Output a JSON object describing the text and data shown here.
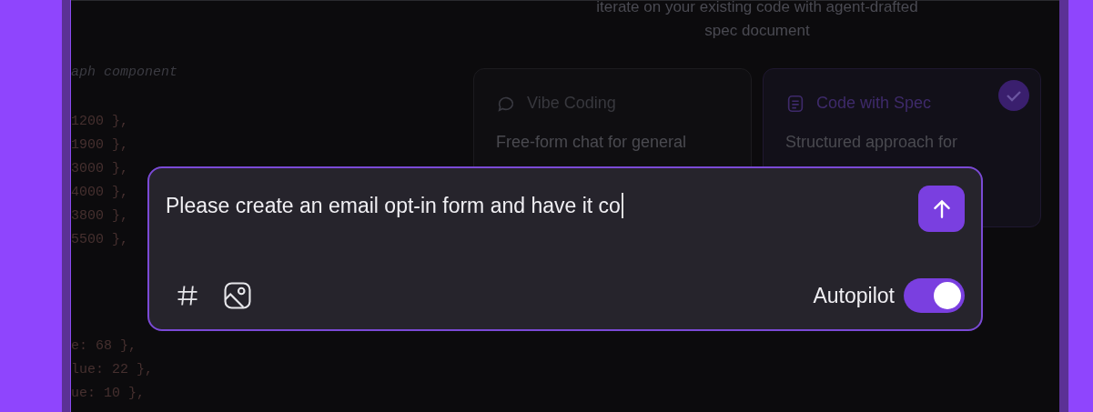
{
  "code_blocks": [
    {
      "lines": [
        {
          "kind": "comment",
          "text": "aph component"
        }
      ]
    },
    {
      "lines": [
        {
          "kind": "value",
          "text": "1200 },"
        },
        {
          "kind": "value",
          "text": "1900 },"
        },
        {
          "kind": "value",
          "text": "3000 },"
        },
        {
          "kind": "value",
          "text": "4000 },"
        },
        {
          "kind": "value",
          "text": "3800 },"
        },
        {
          "kind": "value",
          "text": "5500 },"
        }
      ]
    },
    {
      "lines": [
        {
          "kind": "value",
          "text": "e: 68 },"
        },
        {
          "kind": "value",
          "text": "lue: 22 },"
        },
        {
          "kind": "value",
          "text": "ue: 10 },"
        }
      ]
    }
  ],
  "intro": [
    "iterate on your existing code with agent-drafted",
    "spec document"
  ],
  "modes": [
    {
      "title": "Vibe Coding",
      "description": "Free-form chat for general",
      "selected": false
    },
    {
      "title": "Code with Spec",
      "description": "Structured approach for",
      "selected": true
    }
  ],
  "prompt": {
    "value": "Please create an email opt-in form and have it co",
    "autopilot": {
      "label": "Autopilot",
      "on": true
    }
  }
}
